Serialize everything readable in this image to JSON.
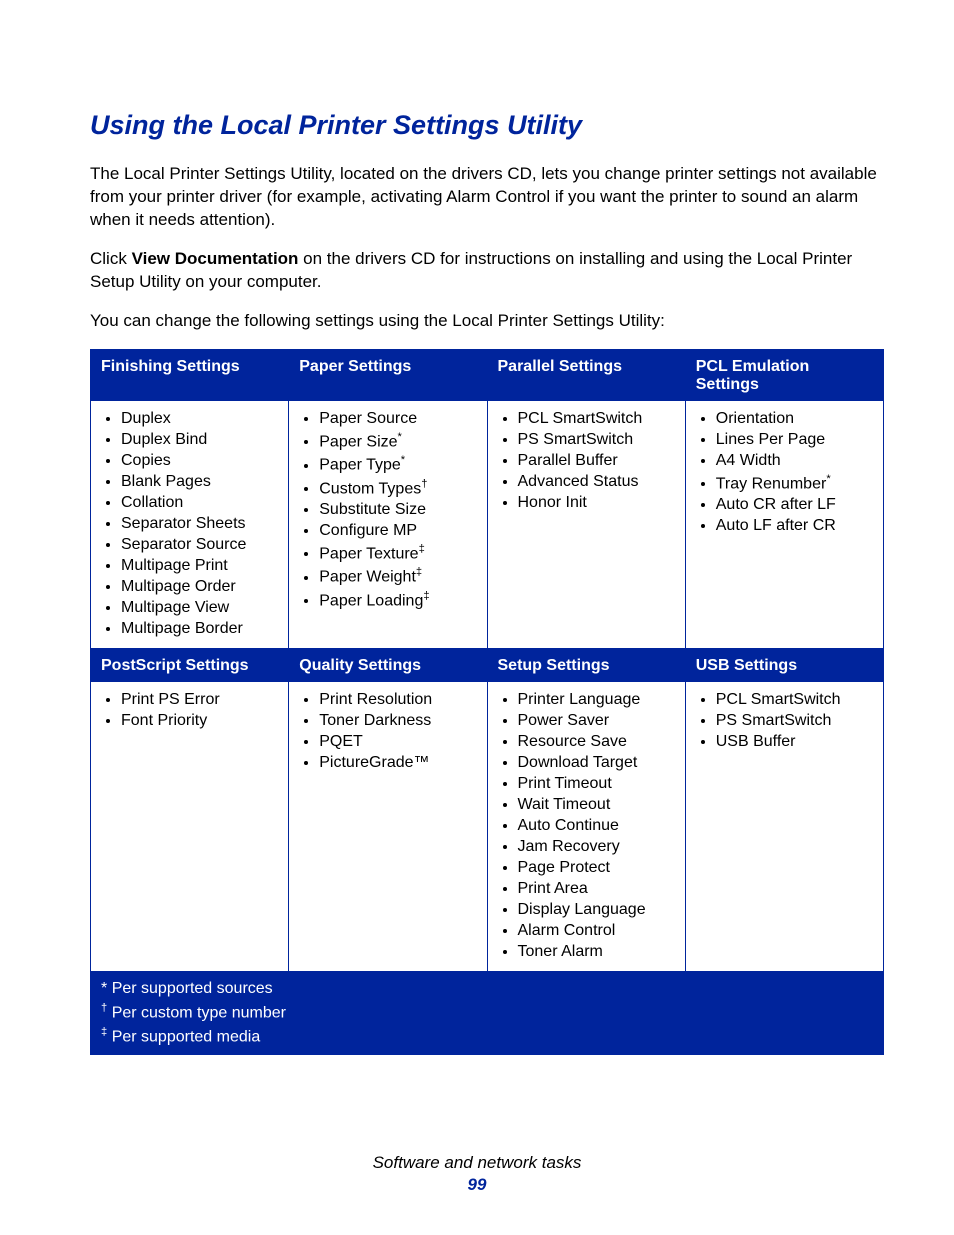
{
  "title": "Using the Local Printer Settings Utility",
  "para1": "The Local Printer Settings Utility, located on the drivers CD, lets you change printer settings not available from your printer driver (for example, activating Alarm Control if you want the printer to sound an alarm when it needs attention).",
  "para2_a": "Click ",
  "para2_b": "View Documentation",
  "para2_c": " on the drivers CD for instructions on installing and using the Local Printer Setup Utility on your computer.",
  "para3": "You can change the following settings using the Local Printer Settings Utility:",
  "headers": {
    "r1c1": "Finishing Settings",
    "r1c2": "Paper Settings",
    "r1c3": "Parallel Settings",
    "r1c4": "PCL Emulation Settings",
    "r2c1": "PostScript Settings",
    "r2c2": "Quality Settings",
    "r2c3": "Setup Settings",
    "r2c4": "USB Settings"
  },
  "cells": {
    "finishing": [
      {
        "t": "Duplex",
        "s": ""
      },
      {
        "t": "Duplex Bind",
        "s": ""
      },
      {
        "t": "Copies",
        "s": ""
      },
      {
        "t": "Blank Pages",
        "s": ""
      },
      {
        "t": "Collation",
        "s": ""
      },
      {
        "t": "Separator Sheets",
        "s": ""
      },
      {
        "t": "Separator Source",
        "s": ""
      },
      {
        "t": "Multipage Print",
        "s": ""
      },
      {
        "t": "Multipage Order",
        "s": ""
      },
      {
        "t": "Multipage View",
        "s": ""
      },
      {
        "t": "Multipage Border",
        "s": ""
      }
    ],
    "paper": [
      {
        "t": "Paper Source",
        "s": ""
      },
      {
        "t": "Paper Size",
        "s": "*"
      },
      {
        "t": "Paper Type",
        "s": "*"
      },
      {
        "t": "Custom Types",
        "s": "†"
      },
      {
        "t": "Substitute Size",
        "s": ""
      },
      {
        "t": "Configure MP",
        "s": ""
      },
      {
        "t": "Paper Texture",
        "s": "‡"
      },
      {
        "t": "Paper Weight",
        "s": "‡"
      },
      {
        "t": "Paper Loading",
        "s": "‡"
      }
    ],
    "parallel": [
      {
        "t": "PCL SmartSwitch",
        "s": ""
      },
      {
        "t": "PS SmartSwitch",
        "s": ""
      },
      {
        "t": "Parallel Buffer",
        "s": ""
      },
      {
        "t": "Advanced Status",
        "s": ""
      },
      {
        "t": "Honor Init",
        "s": ""
      }
    ],
    "pcl": [
      {
        "t": "Orientation",
        "s": ""
      },
      {
        "t": "Lines Per Page",
        "s": ""
      },
      {
        "t": "A4 Width",
        "s": ""
      },
      {
        "t": "Tray Renumber",
        "s": "*"
      },
      {
        "t": "Auto CR after LF",
        "s": ""
      },
      {
        "t": "Auto LF after CR",
        "s": ""
      }
    ],
    "postscript": [
      {
        "t": "Print PS Error",
        "s": ""
      },
      {
        "t": "Font Priority",
        "s": ""
      }
    ],
    "quality": [
      {
        "t": "Print Resolution",
        "s": ""
      },
      {
        "t": "Toner Darkness",
        "s": ""
      },
      {
        "t": "PQET",
        "s": ""
      },
      {
        "t": "PictureGrade™",
        "s": ""
      }
    ],
    "setup": [
      {
        "t": "Printer Language",
        "s": ""
      },
      {
        "t": "Power Saver",
        "s": ""
      },
      {
        "t": "Resource Save",
        "s": ""
      },
      {
        "t": "Download Target",
        "s": ""
      },
      {
        "t": "Print Timeout",
        "s": ""
      },
      {
        "t": "Wait Timeout",
        "s": ""
      },
      {
        "t": "Auto Continue",
        "s": ""
      },
      {
        "t": "Jam Recovery",
        "s": ""
      },
      {
        "t": "Page Protect",
        "s": ""
      },
      {
        "t": "Print Area",
        "s": ""
      },
      {
        "t": "Display Language",
        "s": ""
      },
      {
        "t": "Alarm Control",
        "s": ""
      },
      {
        "t": "Toner Alarm",
        "s": ""
      }
    ],
    "usb": [
      {
        "t": "PCL SmartSwitch",
        "s": ""
      },
      {
        "t": "PS SmartSwitch",
        "s": ""
      },
      {
        "t": "USB Buffer",
        "s": ""
      }
    ]
  },
  "footnotes": {
    "f1": {
      "mark": "*",
      "text": "Per supported sources"
    },
    "f2": {
      "mark": "†",
      "text": "Per custom type number"
    },
    "f3": {
      "mark": "‡",
      "text": "Per supported media"
    }
  },
  "footer": {
    "section": "Software and network tasks",
    "page": "99"
  }
}
